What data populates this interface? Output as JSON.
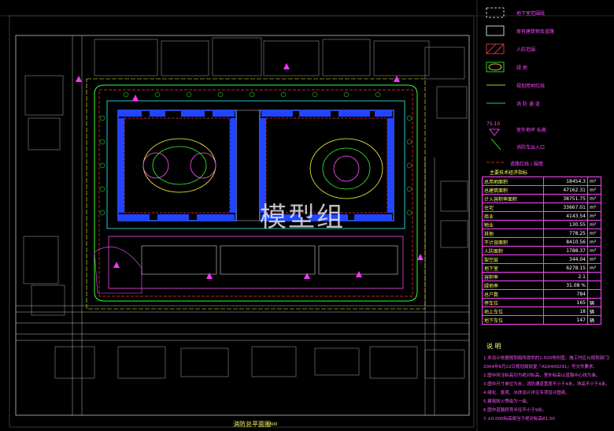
{
  "drawing": {
    "title": "消防总平面图",
    "scale": "1:500",
    "watermark": "模型组"
  },
  "legend": [
    {
      "icon": "dashed-white-box",
      "label": "地下室范围线"
    },
    {
      "icon": "white-box",
      "label": "原有建筑物及道路"
    },
    {
      "icon": "hatched-red-box",
      "label": "人防范围"
    },
    {
      "icon": "green-circle-box",
      "label": "绿 地"
    },
    {
      "icon": "yellow-line",
      "label": "规划用地红线"
    },
    {
      "icon": "cyan-line",
      "label": "消 防 通 道"
    },
    {
      "icon": "level-mark",
      "label": "室外地坪 标高"
    },
    {
      "icon": "green-arrow",
      "label": "消防车出入口"
    },
    {
      "icon": "red-dash",
      "label": "道路红线 / 围墙"
    }
  ],
  "level_value": "75.10",
  "table_title": "主要技术经济指标",
  "table": [
    {
      "label": "总用地面积",
      "value": "18454.3",
      "unit": "m²"
    },
    {
      "label": "总建筑面积",
      "value": "47162.31",
      "unit": "m²"
    },
    {
      "label": "计入容积率面积",
      "value": "38751.75",
      "unit": "m²"
    },
    {
      "label": "住宅",
      "value": "33667.01",
      "unit": "m²"
    },
    {
      "label": "商业",
      "value": "4143.54",
      "unit": "m²"
    },
    {
      "label": "物业",
      "value": "130.55",
      "unit": "m²"
    },
    {
      "label": "其他",
      "value": "778.25",
      "unit": "m²"
    },
    {
      "label": "不计容面积",
      "value": "8410.56",
      "unit": "m²"
    },
    {
      "label": "人防面积",
      "value": "1788.37",
      "unit": "m²"
    },
    {
      "label": "架空层",
      "value": "344.04",
      "unit": "m²"
    },
    {
      "label": "地下室",
      "value": "6278.15",
      "unit": "m²"
    },
    {
      "label": "容积率",
      "value": "2.1",
      "unit": ""
    },
    {
      "label": "绿地率",
      "value": "31.08 %",
      "unit": ""
    },
    {
      "label": "总户数",
      "value": "784",
      "unit": ""
    },
    {
      "label": "停车位",
      "value": "165",
      "unit": "辆"
    },
    {
      "label": "地上车位",
      "value": "18",
      "unit": "辆"
    },
    {
      "label": "地下车位",
      "value": "147",
      "unit": "辆"
    }
  ],
  "notes_title": "说 明",
  "notes": [
    "1.本设计依据规划局所提供的1:500地形图，施工时应以规划部门放线为准。",
    "  2004年6月22日规划局批复『AG0400291』号文件要求。",
    "2.图中所注标高均为绝对标高，室外标高以道路中心线为准。",
    "3.图中尺寸单位为米，消防通道宽度不小于4米，净高不小于4米。",
    "4.绿化、景观、水体设计详见专项设计图纸。",
    "5.建筑耐火等级为一级。",
    "6.图中道路转弯半径不小于9米。",
    "7.±0.000标高相当于绝对标高81.50"
  ]
}
